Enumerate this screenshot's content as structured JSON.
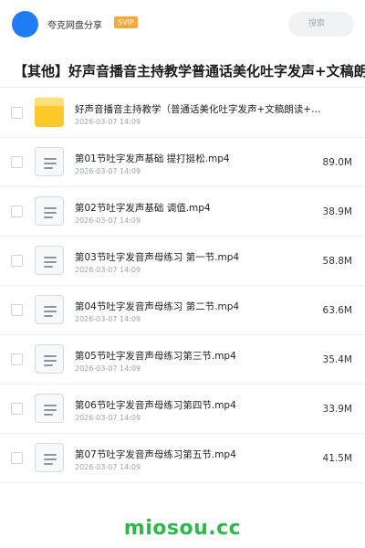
{
  "header": {
    "user_name": "夸克网盘分享",
    "badge": "SVIP",
    "search_placeholder": "搜索"
  },
  "folder": {
    "title": "【其他】好声音播音主持教学普通话美化吐字发声+文稿朗读"
  },
  "files": [
    {
      "name": "好声音播音主持教学（普通话美化吐字发声+文稿朗读+…",
      "date": "2026-03-07 14:09",
      "size": "",
      "type": "folder",
      "icon": "folder-icon"
    },
    {
      "name": "第01节吐字发声基础 提打挺松.mp4",
      "date": "2026-03-07 14:09",
      "size": "89.0M",
      "type": "video",
      "icon": "document-icon"
    },
    {
      "name": "第02节吐字发声基础 调值.mp4",
      "date": "2026-03-07 14:09",
      "size": "38.9M",
      "type": "video",
      "icon": "document-icon"
    },
    {
      "name": "第03节吐字发音声母练习 第一节.mp4",
      "date": "2026-03-07 14:09",
      "size": "58.8M",
      "type": "video",
      "icon": "document-icon"
    },
    {
      "name": "第04节吐字发音声母练习 第二节.mp4",
      "date": "2026-03-07 14:09",
      "size": "63.6M",
      "type": "video",
      "icon": "document-icon"
    },
    {
      "name": "第05节吐字发音声母练习第三节.mp4",
      "date": "2026-03-07 14:09",
      "size": "35.4M",
      "type": "video",
      "icon": "document-icon"
    },
    {
      "name": "第06节吐字发音声母练习第四节.mp4",
      "date": "2026-03-07 14:09",
      "size": "33.9M",
      "type": "video",
      "icon": "document-icon"
    },
    {
      "name": "第07节吐字发音声母练习第五节.mp4",
      "date": "2026-03-07 14:09",
      "size": "41.5M",
      "type": "video",
      "icon": "document-icon"
    }
  ],
  "watermark": "miosou.cc",
  "colors": {
    "accent": "#1e7cf5",
    "svip": "#f7a83b",
    "folder": "#fbc92a",
    "watermark": "#2db84a"
  }
}
